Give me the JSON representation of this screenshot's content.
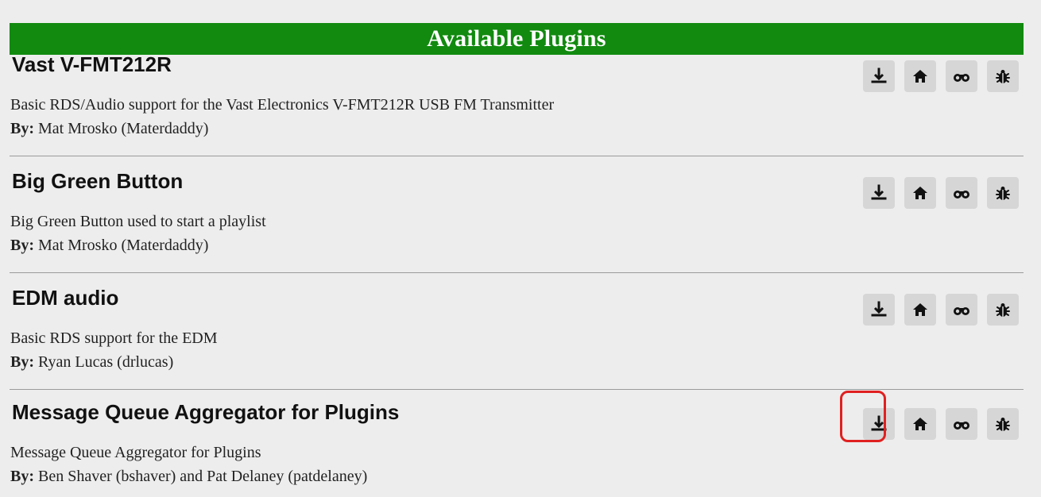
{
  "header": {
    "title": "Available Plugins"
  },
  "plugins": [
    {
      "name": "Vast V-FMT212R",
      "description": "Basic RDS/Audio support for the Vast Electronics V-FMT212R USB FM Transmitter",
      "by_label": "By:",
      "author": "Mat Mrosko (Materdaddy)"
    },
    {
      "name": "Big Green Button",
      "description": "Big Green Button used to start a playlist",
      "by_label": "By:",
      "author": "Mat Mrosko (Materdaddy)"
    },
    {
      "name": "EDM audio",
      "description": "Basic RDS support for the EDM",
      "by_label": "By:",
      "author": "Ryan Lucas (drlucas)"
    },
    {
      "name": "Message Queue Aggregator for Plugins",
      "description": "Message Queue Aggregator for Plugins",
      "by_label": "By:",
      "author": "Ben Shaver (bshaver) and Pat Delaney (patdelaney)"
    }
  ],
  "icons": {
    "download": "download-icon",
    "home": "home-icon",
    "view": "binoculars-icon",
    "bug": "bug-icon"
  },
  "colors": {
    "header_bg": "#118a0f",
    "highlight": "#e02020",
    "button_bg": "#d6d6d6"
  },
  "state": {
    "highlighted_action": "download",
    "highlighted_plugin_index": 3
  }
}
